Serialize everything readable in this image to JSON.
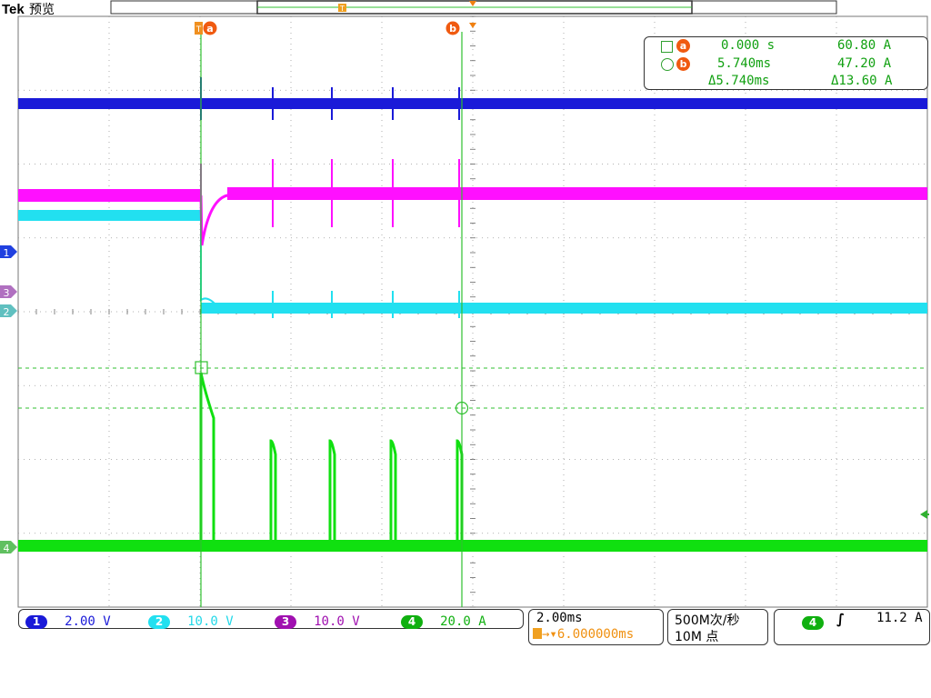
{
  "header": {
    "brand": "Tek",
    "mode": "预览"
  },
  "cursor_markers": {
    "trigger": "T",
    "a": "a",
    "b": "b"
  },
  "readout": {
    "row_a": {
      "label": "a",
      "time": "0.000 s",
      "value": "60.80 A"
    },
    "row_b": {
      "label": "b",
      "time": "5.740ms",
      "value": "47.20 A"
    },
    "row_delta": {
      "time": "Δ5.740ms",
      "value": "Δ13.60 A"
    }
  },
  "channel_markers": [
    "1",
    "3",
    "2",
    "4"
  ],
  "channels": [
    {
      "num": "1",
      "scale": "2.00 V",
      "color": "#1a1ad8"
    },
    {
      "num": "2",
      "scale": "10.0 V",
      "color": "#22e0f0"
    },
    {
      "num": "3",
      "scale": "10.0 V",
      "color": "#a010b0"
    },
    {
      "num": "4",
      "scale": "20.0 A",
      "color": "#10b010"
    }
  ],
  "timebase": {
    "scale": "2.00ms",
    "delay": "6.000000ms"
  },
  "acquisition": {
    "rate": "500M次/秒",
    "points": "10M 点"
  },
  "trigger": {
    "source": "4",
    "level": "11.2 A"
  },
  "colors": {
    "ch1": "#1a1ad8",
    "ch2": "#22e0f0",
    "ch3": "#ff10ff",
    "ch4": "#10e010",
    "cursor": "#30c030",
    "marker_orange": "#f06010"
  }
}
